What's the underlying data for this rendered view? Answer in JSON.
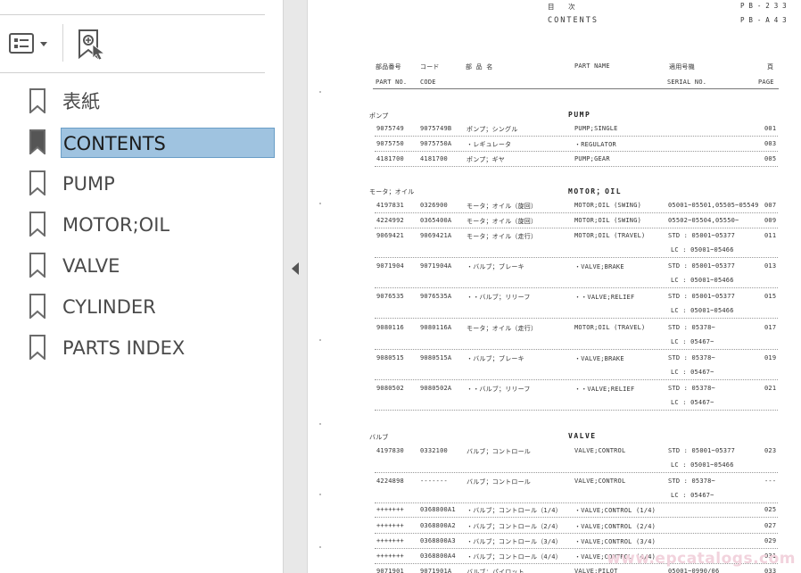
{
  "bookmarks_panel": {
    "options_icon": "bookmark-options-icon",
    "add_icon": "add-bookmark-icon",
    "items": [
      {
        "label": "表紙",
        "selected": false
      },
      {
        "label": "CONTENTS",
        "selected": true
      },
      {
        "label": "PUMP",
        "selected": false
      },
      {
        "label": "MOTOR;OIL",
        "selected": false
      },
      {
        "label": "VALVE",
        "selected": false
      },
      {
        "label": "CYLINDER",
        "selected": false
      },
      {
        "label": "PARTS INDEX",
        "selected": false
      }
    ],
    "collapse_icon": "collapse-left-icon"
  },
  "document": {
    "header": {
      "jp_title": "目　　次",
      "en_title": "CONTENTS",
      "code1": "P B - 2 3 3",
      "code2": "P B - A 4 3"
    },
    "columns": {
      "part_no_jp": "部品番号",
      "code_jp": "コード",
      "name_jp": "部 品 名",
      "part_name": "PART NAME",
      "serial_jp": "適用号機",
      "page_jp": "頁",
      "part_no": "PART NO.",
      "code": "CODE",
      "serial_no": "SERIAL NO.",
      "page": "PAGE"
    },
    "sections": [
      {
        "jp": "ポンプ",
        "en": "PUMP"
      },
      {
        "jp": "モータ；オイル",
        "en": "MOTOR；OIL"
      },
      {
        "jp": "バルブ",
        "en": "VALVE"
      }
    ],
    "rows": [
      {
        "part_no": "9075749",
        "code": "9075749B",
        "jp": "ポンプ；シングル",
        "en": "PUMP;SINGLE",
        "serial": "",
        "serial2": "",
        "page": "001"
      },
      {
        "part_no": "9075750",
        "code": "9075750A",
        "jp": "・レギュレータ",
        "en": "・REGULATOR",
        "serial": "",
        "serial2": "",
        "page": "003"
      },
      {
        "part_no": "4181700",
        "code": "4181700",
        "jp": "ポンプ；ギヤ",
        "en": "PUMP;GEAR",
        "serial": "",
        "serial2": "",
        "page": "005"
      },
      {
        "part_no": "4197831",
        "code": "0326900",
        "jp": "モータ；オイル（旋回）",
        "en": "MOTOR;OIL (SWING)",
        "serial": "05001~05501,05505~05549",
        "serial2": "",
        "page": "007"
      },
      {
        "part_no": "4224992",
        "code": "0365400A",
        "jp": "モータ；オイル（旋回）",
        "en": "MOTOR;OIL (SWING)",
        "serial": "05502~05504,05550~",
        "serial2": "",
        "page": "009"
      },
      {
        "part_no": "9069421",
        "code": "9069421A",
        "jp": "モータ；オイル（走行）",
        "en": "MOTOR;OIL (TRAVEL)",
        "serial": "STD : 05001~05377",
        "serial2": "LC : 05001~05466",
        "page": "011"
      },
      {
        "part_no": "9071904",
        "code": "9071904A",
        "jp": "・バルブ；ブレーキ",
        "en": "・VALVE;BRAKE",
        "serial": "STD : 05001~05377",
        "serial2": "LC : 05001~05466",
        "page": "013"
      },
      {
        "part_no": "9076535",
        "code": "9076535A",
        "jp": "・・バルブ；リリーフ",
        "en": "・・VALVE;RELIEF",
        "serial": "STD : 05001~05377",
        "serial2": "LC : 05001~05466",
        "page": "015"
      },
      {
        "part_no": "9080116",
        "code": "9080116A",
        "jp": "モータ；オイル（走行）",
        "en": "MOTOR;OIL (TRAVEL)",
        "serial": "STD : 05378~",
        "serial2": "LC : 05467~",
        "page": "017"
      },
      {
        "part_no": "9080515",
        "code": "9080515A",
        "jp": "・バルブ；ブレーキ",
        "en": "・VALVE;BRAKE",
        "serial": "STD : 05378~",
        "serial2": "LC : 05467~",
        "page": "019"
      },
      {
        "part_no": "9080502",
        "code": "9080502A",
        "jp": "・・バルブ；リリーフ",
        "en": "・・VALVE;RELIEF",
        "serial": "STD : 05378~",
        "serial2": "LC : 05467~",
        "page": "021"
      },
      {
        "part_no": "4197830",
        "code": "0332100",
        "jp": "バルブ；コントロール",
        "en": "VALVE;CONTROL",
        "serial": "STD : 05001~05377",
        "serial2": "LC : 05001~05466",
        "page": "023"
      },
      {
        "part_no": "4224898",
        "code": "-------",
        "jp": "バルブ；コントロール",
        "en": "VALVE;CONTROL",
        "serial": "STD : 05378~",
        "serial2": "LC : 05467~",
        "page": "---"
      },
      {
        "part_no": "+++++++",
        "code": "0368800A1",
        "jp": "・バルブ；コントロール（1/4）",
        "en": "・VALVE;CONTROL (1/4)",
        "serial": "",
        "serial2": "",
        "page": "025"
      },
      {
        "part_no": "+++++++",
        "code": "0368800A2",
        "jp": "・バルブ；コントロール（2/4）",
        "en": "・VALVE;CONTROL (2/4)",
        "serial": "",
        "serial2": "",
        "page": "027"
      },
      {
        "part_no": "+++++++",
        "code": "0368800A3",
        "jp": "・バルブ；コントロール（3/4）",
        "en": "・VALVE;CONTROL (3/4)",
        "serial": "",
        "serial2": "",
        "page": "029"
      },
      {
        "part_no": "+++++++",
        "code": "0368800A4",
        "jp": "・バルブ；コントロール（4/4）",
        "en": "・VALVE;CONTROL (4/4)",
        "serial": "",
        "serial2": "",
        "page": "031"
      },
      {
        "part_no": "9071901",
        "code": "9071901A",
        "jp": "バルブ；パイロット",
        "en": "VALVE;PILOT",
        "serial": "05001~0990/06",
        "serial2": "",
        "page": "033"
      }
    ],
    "watermark": "www.epcatalogs.com"
  },
  "colors": {
    "selected_bg": "#9fc3e0",
    "panel_bg": "#ffffff",
    "strip_bg": "#e8e8e8"
  }
}
